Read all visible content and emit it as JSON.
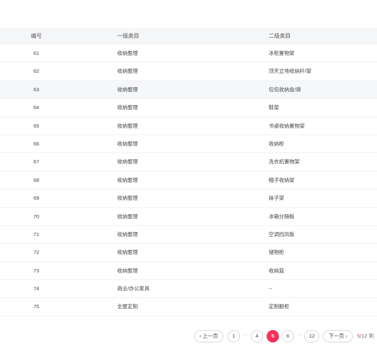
{
  "table": {
    "headers": [
      "编号",
      "一级类目",
      "二级类目"
    ],
    "rows": [
      {
        "id": "61",
        "level1": "收纳整理",
        "level2": "冰柜置物架"
      },
      {
        "id": "62",
        "level1": "收纳整理",
        "level2": "顶天立地收纳杆/架"
      },
      {
        "id": "63",
        "level1": "收纳整理",
        "level2": "包包收纳盒/袋"
      },
      {
        "id": "64",
        "level1": "收纳整理",
        "level2": "鞋架"
      },
      {
        "id": "65",
        "level1": "收纳整理",
        "level2": "书桌收纳置物架"
      },
      {
        "id": "66",
        "level1": "收纳整理",
        "level2": "收纳柜"
      },
      {
        "id": "67",
        "level1": "收纳整理",
        "level2": "洗衣机置物架"
      },
      {
        "id": "68",
        "level1": "收纳整理",
        "level2": "帽子收纳架"
      },
      {
        "id": "69",
        "level1": "收纳整理",
        "level2": "袜子架"
      },
      {
        "id": "70",
        "level1": "收纳整理",
        "level2": "冰箱分隔板"
      },
      {
        "id": "71",
        "level1": "收纳整理",
        "level2": "空调挡风板"
      },
      {
        "id": "72",
        "level1": "收纳整理",
        "level2": "储物柜"
      },
      {
        "id": "73",
        "level1": "收纳整理",
        "level2": "收纳篮"
      },
      {
        "id": "74",
        "level1": "商业/办公家具",
        "level2": "--"
      },
      {
        "id": "75",
        "level1": "全屋定制",
        "level2": "定制橱柜"
      }
    ]
  },
  "pagination": {
    "prev_label": "‹ 上一页",
    "next_label": "下一页 ›",
    "pages": [
      "1",
      "4",
      "5",
      "6",
      "12"
    ],
    "ellipsis": "···",
    "current_page": "5",
    "total_suffix": "/12",
    "goto_label": "到"
  },
  "colors": {
    "accent": "#f5335a",
    "header_bg": "#f5f6f8",
    "highlight_row": "#f5f7fb"
  }
}
